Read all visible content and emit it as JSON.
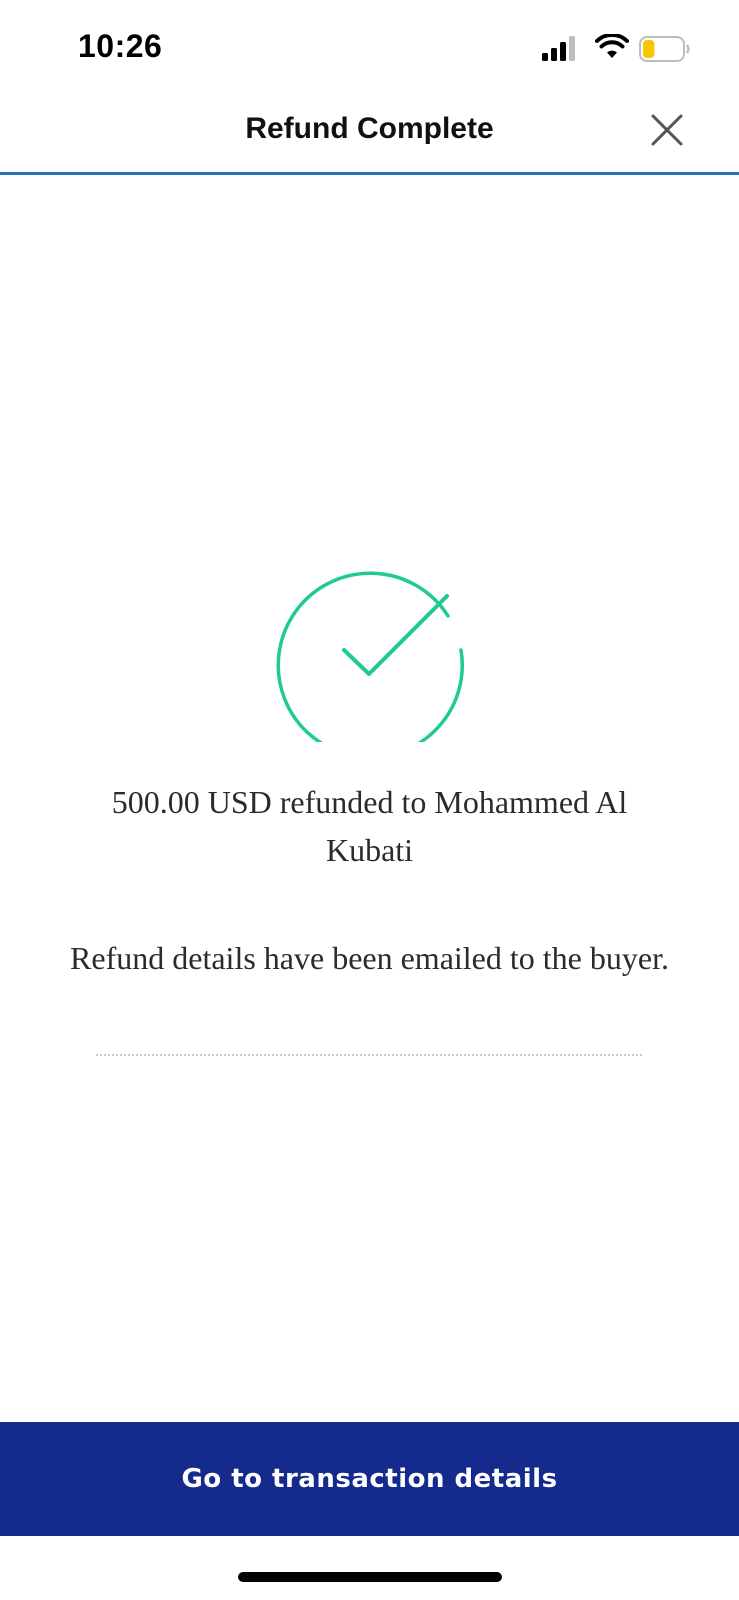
{
  "status_bar": {
    "time": "10:26",
    "icons": [
      "signal-icon",
      "wifi-icon",
      "battery-icon"
    ],
    "battery_level": 0.3,
    "battery_color": "#f5c800"
  },
  "header": {
    "title": "Refund Complete",
    "close_icon": "close-icon",
    "divider_color": "#2a73b8"
  },
  "result": {
    "icon": "checkmark-circle-icon",
    "icon_color": "#1fcb92",
    "message": "500.00 USD refunded to Mohammed Al Kubati",
    "notice": "Refund details have been emailed to the buyer."
  },
  "footer": {
    "cta_label": "Go to transaction details",
    "cta_color": "#142a8c"
  }
}
